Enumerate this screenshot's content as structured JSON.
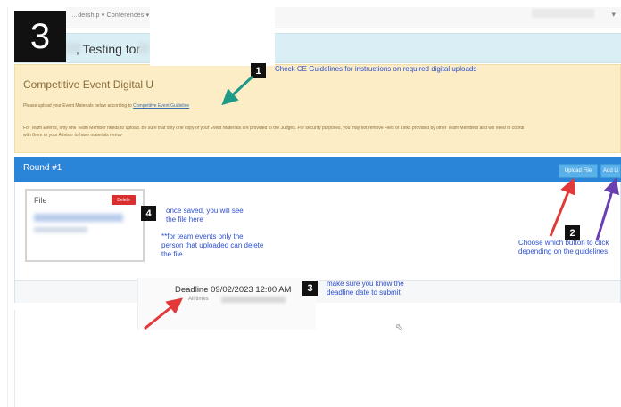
{
  "nav": {
    "items": "…dership ▾   Conferences ▾   Reg",
    "icon": "user-icon"
  },
  "step_main": "3",
  "greeting": ", Testing for",
  "info": {
    "title": "Competitive Event Digital U",
    "line1_prefix": "Please upload your Event Materials below according to ",
    "line1_link": "Competitive Event Guideline",
    "line2": "For Team Events, only one Team Member needs to upload. Be sure that only one copy of your Event Materials are provided to the Judges. For security purposes, you may not remove Files or Links provided by other Team Members and will need to coordi",
    "line3": "with them or your Adviser to have materials remov"
  },
  "annotations": {
    "n1": "1",
    "n1_text": "Check CE Guidelines for instructions on required digital uploads",
    "n2": "2",
    "n2_text": "Choose which button to click depending on the guidelines",
    "n3": "3",
    "n3_text_line1": "make sure you know the",
    "n3_text_line2": "deadline date to submit",
    "n4": "4",
    "n4_text_line1": "once saved, you will see",
    "n4_text_line2": "the file here",
    "n4_text_line3": "**for team events only the",
    "n4_text_line4": "person that uploaded can delete",
    "n4_text_line5": "the file"
  },
  "round": {
    "title": "Round #1",
    "upload_button": "Upload File",
    "add_link_button": "Add Li"
  },
  "file_card": {
    "label": "File",
    "delete_button": "Delete"
  },
  "deadline": {
    "label": "Deadline 09/02/2023 12:00 AM",
    "sub": "All times"
  },
  "colors": {
    "round_header": "#2a84d8",
    "info_panel": "#fcedc6",
    "greeting_bar": "#d9eef5",
    "annotation_blue": "#2b4fcf",
    "arrow_red": "#e23a3a",
    "arrow_teal": "#1f9a86",
    "arrow_purple": "#6a3fb0",
    "delete_red": "#d9302f"
  }
}
